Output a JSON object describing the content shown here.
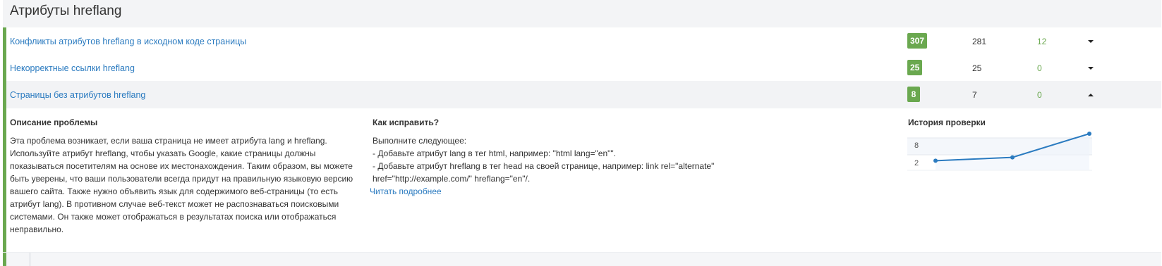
{
  "section": {
    "title": "Атрибуты hreflang"
  },
  "issues": [
    {
      "title": "Конфликты атрибутов hreflang в исходном коде страницы",
      "total": "307",
      "count": "281",
      "delta": "12",
      "expanded": false
    },
    {
      "title": "Некорректные ссылки hreflang",
      "total": "25",
      "count": "25",
      "delta": "0",
      "expanded": false
    },
    {
      "title": "Страницы без атрибутов hreflang",
      "total": "8",
      "count": "7",
      "delta": "0",
      "expanded": true
    }
  ],
  "detail": {
    "description_title": "Описание проблемы",
    "description_lines": [
      "Эта проблема возникает, если ваша страница не имеет атрибута lang и hreflang.",
      "Используйте атрибут hreflang, чтобы указать Google, какие страницы должны",
      "показываться посетителям на основе их местонахождения. Таким образом, вы можете",
      "быть уверены, что ваши пользователи всегда придут на правильную языковую версию",
      "вашего сайта. Также нужно объявить язык для содержимого веб-страницы (то есть",
      "атрибут lang). В противном случае веб-текст может не распознаваться поисковыми",
      "системами. Он также может отображаться в результатах поиска или отображаться",
      "неправильно."
    ],
    "fix_title": "Как исправить?",
    "fix_lines": [
      "Выполните следующее:",
      "- Добавьте атрибут lang в тег html, например: \"html lang=\"en\"\".",
      "- Добавьте атрибут hreflang в тег head на своей странице, например: link rel=\"alternate\"",
      "href=\"http://example.com/\" hreflang=\"en\"/."
    ],
    "read_more": "Читать подробнее",
    "history_title": "История проверки"
  },
  "chart_data": {
    "type": "line",
    "title": "История проверки",
    "xlabel": "",
    "ylabel": "",
    "ylim": [
      0,
      10
    ],
    "ytick_labels": [
      "2",
      "8"
    ],
    "x": [
      1,
      2,
      3
    ],
    "series": [
      {
        "values": [
          2,
          3,
          10
        ]
      }
    ],
    "grid": true,
    "colors": {
      "line": "#2b7bc0",
      "fill": "#eef4fb"
    }
  },
  "colors": {
    "accent_green": "#6aa84f",
    "link_blue": "#2b7bc0"
  },
  "icons": {
    "collapsed": "chevron-down-icon",
    "expanded": "chevron-up-icon"
  }
}
